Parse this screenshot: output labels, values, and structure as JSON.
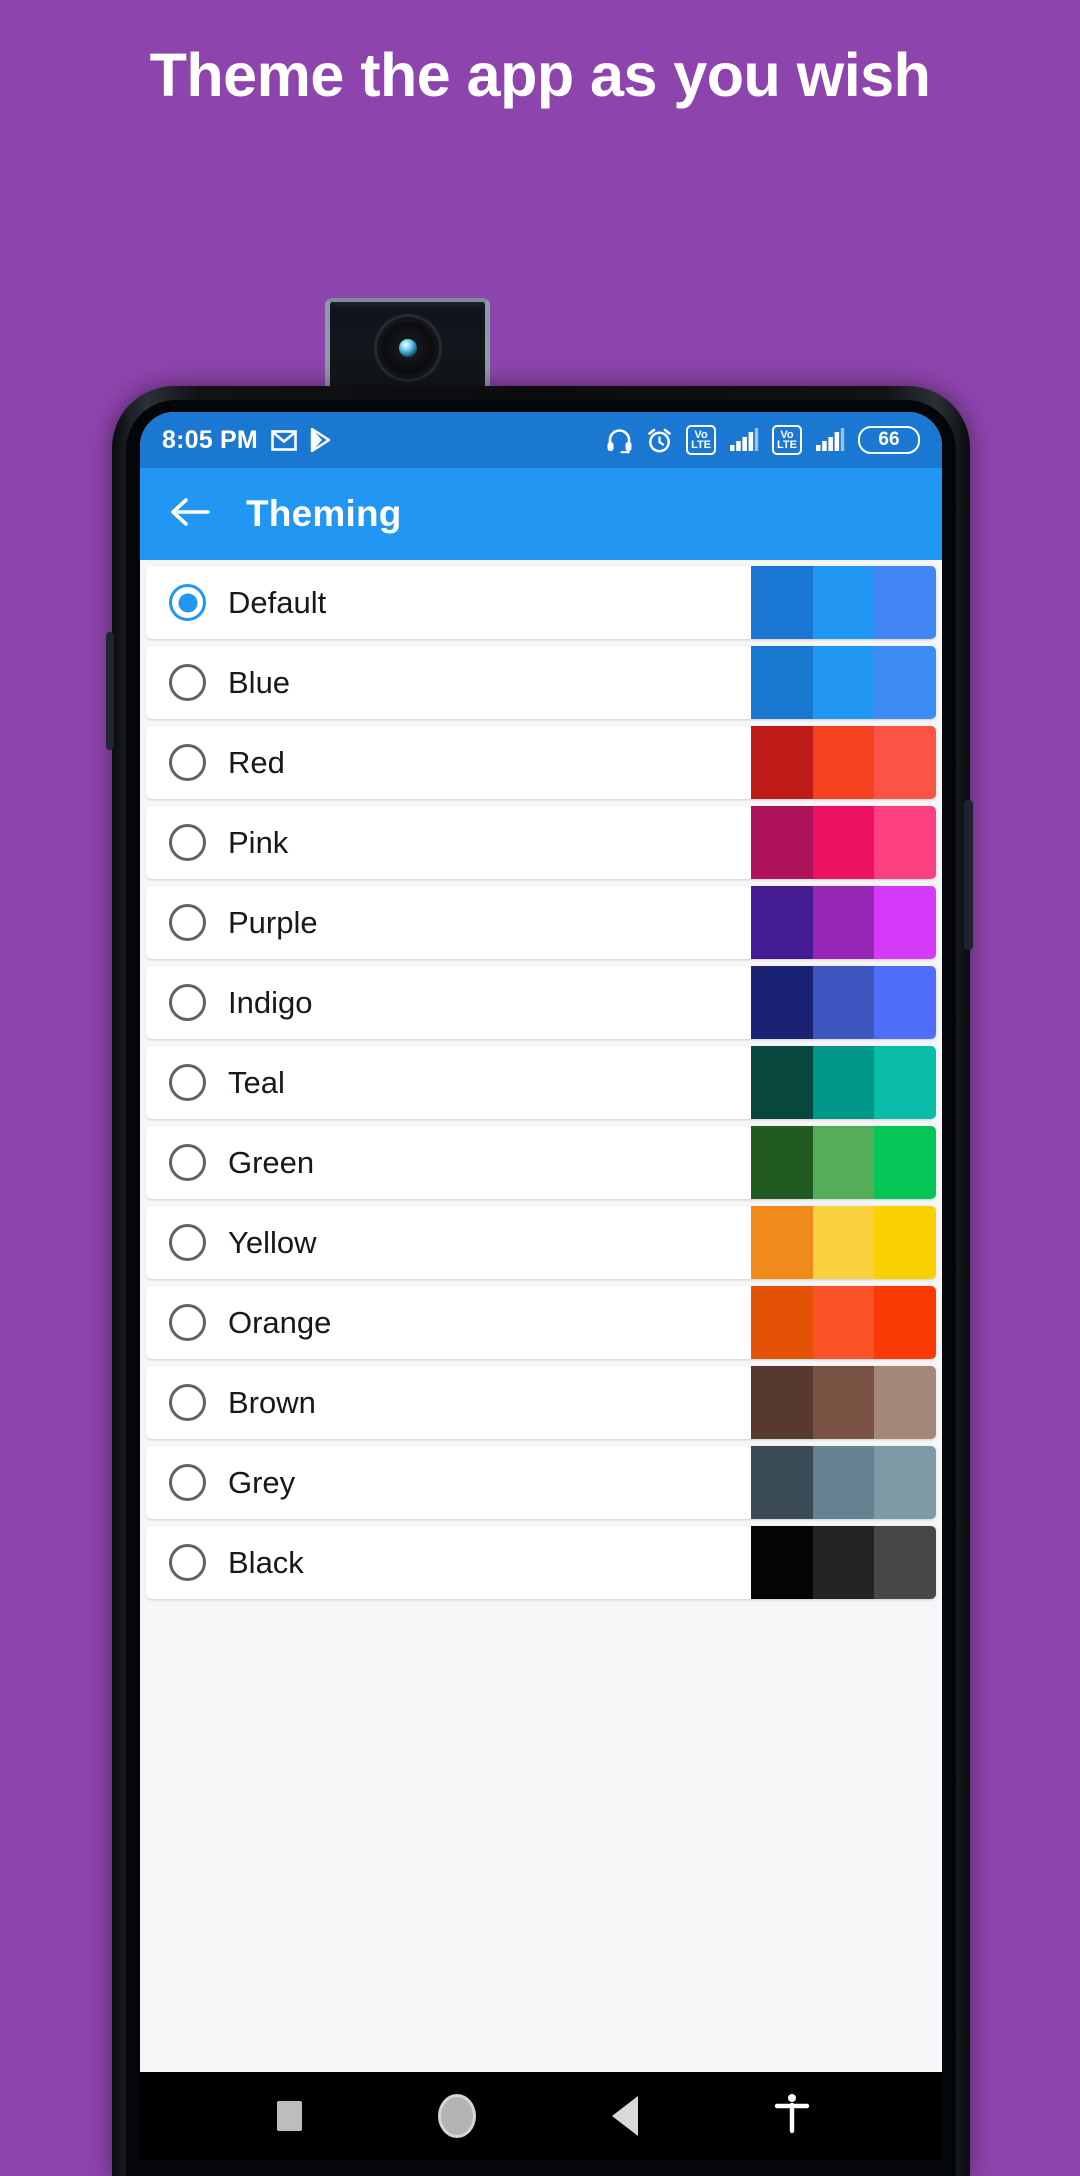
{
  "promo": {
    "headline": "Theme the app as you wish",
    "background_color": "#8E44AD",
    "text_color": "#FFFFFF"
  },
  "device": {
    "frame_color": "#0B0C0F",
    "popup_camera": "popup-selfie-camera"
  },
  "status_bar": {
    "background_color": "#1A78D2",
    "time": "8:05 PM",
    "left_icons": [
      "gmail-icon",
      "play-store-icon"
    ],
    "right_icons": [
      "headset-icon",
      "alarm-icon",
      "volte-icon",
      "signal-icon",
      "volte-icon",
      "signal-icon"
    ],
    "volte_top": "Vo",
    "volte_bottom": "LTE",
    "battery_level": "66"
  },
  "app_bar": {
    "background_color": "#2196F3",
    "title": "Theming",
    "back_icon": "arrow-left-icon"
  },
  "theme_list": {
    "selected": "Default",
    "items": [
      {
        "label": "Default",
        "selected": true,
        "swatches": [
          "#1976D2",
          "#2196F3",
          "#4285F4"
        ]
      },
      {
        "label": "Blue",
        "selected": false,
        "swatches": [
          "#1877CE",
          "#2196F3",
          "#3D8BF5"
        ]
      },
      {
        "label": "Red",
        "selected": false,
        "swatches": [
          "#BE1B18",
          "#F4411F",
          "#FB5345"
        ]
      },
      {
        "label": "Pink",
        "selected": false,
        "swatches": [
          "#AD125A",
          "#EE1362",
          "#FB3F80"
        ]
      },
      {
        "label": "Purple",
        "selected": false,
        "swatches": [
          "#451C94",
          "#9726B5",
          "#D53AFA"
        ]
      },
      {
        "label": "Indigo",
        "selected": false,
        "swatches": [
          "#1B2273",
          "#3E56C0",
          "#4F6FFB"
        ]
      },
      {
        "label": "Teal",
        "selected": false,
        "swatches": [
          "#07473E",
          "#009688",
          "#09BCA7"
        ]
      },
      {
        "label": "Green",
        "selected": false,
        "swatches": [
          "#215B21",
          "#53AD59",
          "#04C656"
        ]
      },
      {
        "label": "Yellow",
        "selected": false,
        "swatches": [
          "#F08A1B",
          "#FBD13F",
          "#FBD000"
        ]
      },
      {
        "label": "Orange",
        "selected": false,
        "swatches": [
          "#E35205",
          "#FB5227",
          "#FB3A04"
        ]
      },
      {
        "label": "Brown",
        "selected": false,
        "swatches": [
          "#58392F",
          "#7A5344",
          "#A38779"
        ]
      },
      {
        "label": "Grey",
        "selected": false,
        "swatches": [
          "#3A4B56",
          "#66818F",
          "#7E9AA7"
        ]
      },
      {
        "label": "Black",
        "selected": false,
        "swatches": [
          "#050505",
          "#232323",
          "#474747"
        ]
      }
    ]
  },
  "nav_bar": {
    "background_color": "#000000",
    "buttons": [
      "recents-button",
      "home-button",
      "back-button",
      "accessibility-button"
    ]
  }
}
